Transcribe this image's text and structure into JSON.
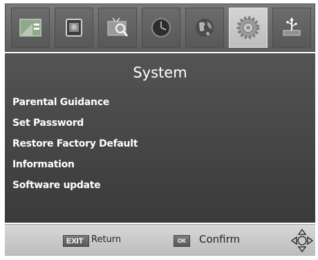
{
  "topbar": {
    "tabs": [
      {
        "icon": "channel-list-icon",
        "active": false
      },
      {
        "icon": "picture-icon",
        "active": false
      },
      {
        "icon": "channel-search-icon",
        "active": false
      },
      {
        "icon": "clock-icon",
        "active": false
      },
      {
        "icon": "globe-icon",
        "active": false
      },
      {
        "icon": "gear-icon",
        "active": true
      },
      {
        "icon": "usb-icon",
        "active": false
      }
    ]
  },
  "main": {
    "title": "System",
    "items": [
      {
        "label": "Parental Guidance"
      },
      {
        "label": "Set Password"
      },
      {
        "label": "Restore Factory Default"
      },
      {
        "label": "Information"
      },
      {
        "label": "Software update"
      }
    ]
  },
  "footer": {
    "exit_key": "EXIT",
    "return_label": "Return",
    "ok_key": "OK",
    "confirm_label": "Confirm",
    "nav_icon": "navigation-arrows-icon"
  },
  "colors": {
    "panel": "#4a4a4a",
    "active_tab": "#c8c8c8",
    "text": "#ffffff",
    "footer": "#cccccc"
  }
}
